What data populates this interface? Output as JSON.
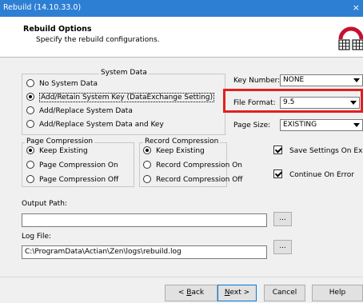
{
  "window": {
    "title": "Rebuild (14.10.33.0)",
    "close_glyph": "×"
  },
  "header": {
    "title": "Rebuild Options",
    "subtitle": "Specify the rebuild configurations.",
    "logo_icon": "rebuild-wizard-icon"
  },
  "system_data": {
    "legend": "System Data",
    "options": [
      {
        "label": "No System Data",
        "selected": false
      },
      {
        "label": "Add/Retain System Key (DataExchange Setting)",
        "selected": true
      },
      {
        "label": "Add/Replace System Data",
        "selected": false
      },
      {
        "label": "Add/Replace System Data and Key",
        "selected": false
      }
    ]
  },
  "key_number": {
    "label": "Key Number:",
    "value": "NONE"
  },
  "file_format": {
    "label": "File Format:",
    "value": "9.5"
  },
  "page_size": {
    "label": "Page Size:",
    "value": "EXISTING"
  },
  "page_compression": {
    "legend": "Page Compression",
    "options": [
      {
        "label": "Keep Existing",
        "selected": true
      },
      {
        "label": "Page Compression On",
        "selected": false
      },
      {
        "label": "Page Compression Off",
        "selected": false
      }
    ]
  },
  "record_compression": {
    "legend": "Record Compression",
    "options": [
      {
        "label": "Keep Existing",
        "selected": true
      },
      {
        "label": "Record Compression On",
        "selected": false
      },
      {
        "label": "Record Compression Off",
        "selected": false
      }
    ]
  },
  "checkboxes": {
    "save_settings": {
      "label": "Save Settings On Exit",
      "checked": true
    },
    "continue_on_error": {
      "label": "Continue On Error",
      "checked": true
    }
  },
  "output_path": {
    "label": "Output Path:",
    "value": "",
    "browse_label": "..."
  },
  "log_file": {
    "label": "Log File:",
    "value": "C:\\ProgramData\\Actian\\Zen\\logs\\rebuild.log",
    "browse_label": "..."
  },
  "buttons": {
    "back": {
      "mnemonic": "B",
      "rest": "ack",
      "prefix": "< "
    },
    "next": {
      "mnemonic": "N",
      "rest": "ext",
      "suffix": " >"
    },
    "cancel": "Cancel",
    "help": "Help"
  },
  "colors": {
    "titlebar": "#2d7fd4",
    "highlight_box": "#e02020"
  }
}
